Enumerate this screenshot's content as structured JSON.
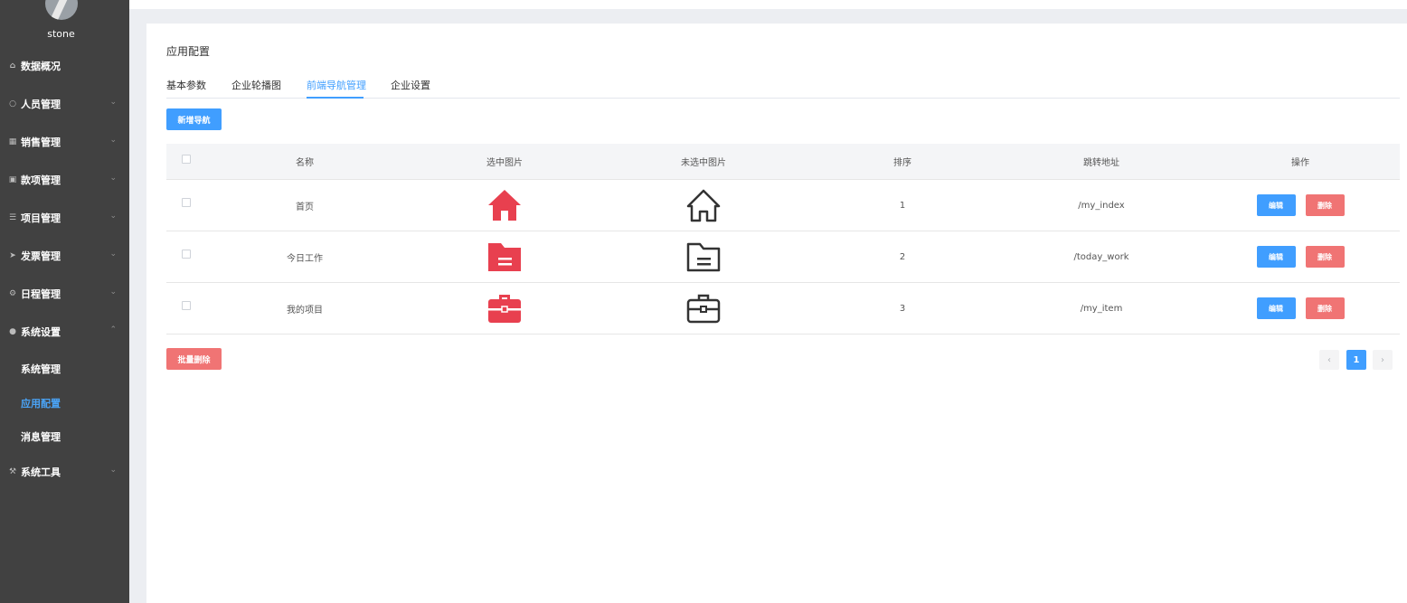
{
  "user": {
    "name": "stone"
  },
  "sidebar": {
    "items": [
      {
        "label": "数据概况",
        "icon": "home-icon"
      },
      {
        "label": "人员管理",
        "icon": "user-icon"
      },
      {
        "label": "销售管理",
        "icon": "cart-icon"
      },
      {
        "label": "款项管理",
        "icon": "money-icon"
      },
      {
        "label": "项目管理",
        "icon": "database-icon"
      },
      {
        "label": "发票管理",
        "icon": "send-icon"
      },
      {
        "label": "日程管理",
        "icon": "gear-icon"
      },
      {
        "label": "系统设置",
        "icon": "users-icon"
      },
      {
        "label": "系统工具",
        "icon": "wrench-icon"
      }
    ],
    "sub_items": [
      {
        "label": "系统管理"
      },
      {
        "label": "应用配置"
      },
      {
        "label": "消息管理"
      }
    ]
  },
  "page": {
    "title": "应用配置"
  },
  "tabs": [
    {
      "label": "基本参数"
    },
    {
      "label": "企业轮播图"
    },
    {
      "label": "前端导航管理"
    },
    {
      "label": "企业设置"
    }
  ],
  "actions": {
    "add_label": "新增导航",
    "batch_delete_label": "批量删除"
  },
  "table": {
    "headers": [
      "名称",
      "选中图片",
      "未选中图片",
      "排序",
      "跳转地址",
      "操作"
    ],
    "rows": [
      {
        "name": "首页",
        "icon": "home-icon",
        "sort": "1",
        "url": "/my_index"
      },
      {
        "name": "今日工作",
        "icon": "folder-icon",
        "sort": "2",
        "url": "/today_work"
      },
      {
        "name": "我的项目",
        "icon": "briefcase-icon",
        "sort": "3",
        "url": "/my_item"
      }
    ],
    "edit_label": "编辑",
    "delete_label": "删除"
  },
  "pagination": {
    "current": "1",
    "prev": "‹",
    "next": "›"
  },
  "colors": {
    "accent": "#409eff",
    "danger": "#f07474",
    "selected_icon": "#e8404f",
    "unselected_icon": "#333333",
    "sidebar_bg": "#414141"
  }
}
